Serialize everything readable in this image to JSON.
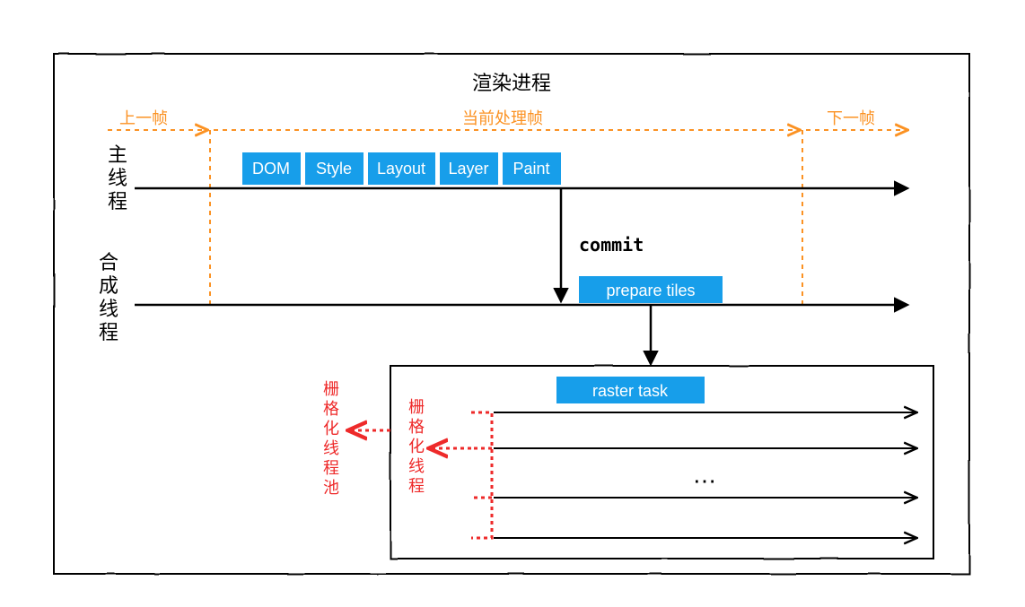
{
  "title": "渲染进程",
  "frames": {
    "prev": "上一帧",
    "current": "当前处理帧",
    "next": "下一帧"
  },
  "lanes": {
    "main": "主线程",
    "compositor": "合成线程"
  },
  "pipeline": {
    "p0": "DOM",
    "p1": "Style",
    "p2": "Layout",
    "p3": "Layer",
    "p4": "Paint"
  },
  "commit_label": "commit",
  "compositor_box": "prepare tiles",
  "raster": {
    "task_box": "raster task",
    "thread_label": "栅格化线程",
    "pool_label": "栅格化线程池",
    "ellipsis": "⋯"
  },
  "colors": {
    "blue": "#179eea",
    "orange": "#fb9223",
    "red": "#ee2a2a",
    "black": "#000000"
  }
}
